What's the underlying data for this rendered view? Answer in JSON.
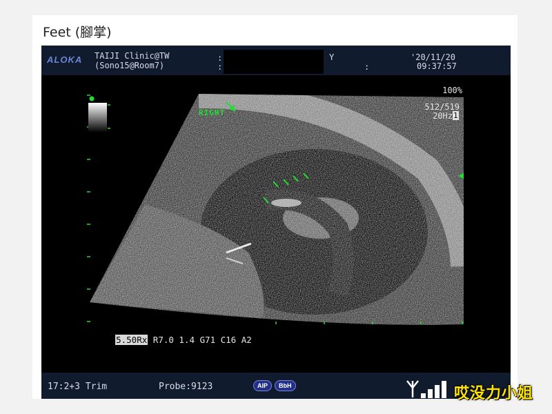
{
  "caption": "Feet (腳掌)",
  "header": {
    "logo": "ALOKA",
    "clinic_line1": "TAIJI Clinic@TW",
    "clinic_line2": "(Sono15@Room7)",
    "colon1": ":",
    "colon2": ":",
    "y_label": "Y",
    "colon3": ":",
    "date": "'20/11/20",
    "time": "09:37:57"
  },
  "readouts": {
    "gain": "100%",
    "frame": "512/519",
    "rate": "20Hz",
    "rate_badge": "1"
  },
  "annotation": "RIGHT",
  "params": {
    "freq": "5.50Rx",
    "rest": " R7.0 1.4 G71 C16 A2"
  },
  "status": {
    "mode": "17:2+3 Trim",
    "probe": "Probe:9123",
    "badge_aip": "AIP",
    "badge_bbh": "BbH"
  },
  "watermark": "哎没力小姐",
  "colors": {
    "header_bg": "#111b2e",
    "marker_green": "#22dd33",
    "logo_blue": "#6a86d6",
    "watermark_yellow": "#ffe400"
  }
}
